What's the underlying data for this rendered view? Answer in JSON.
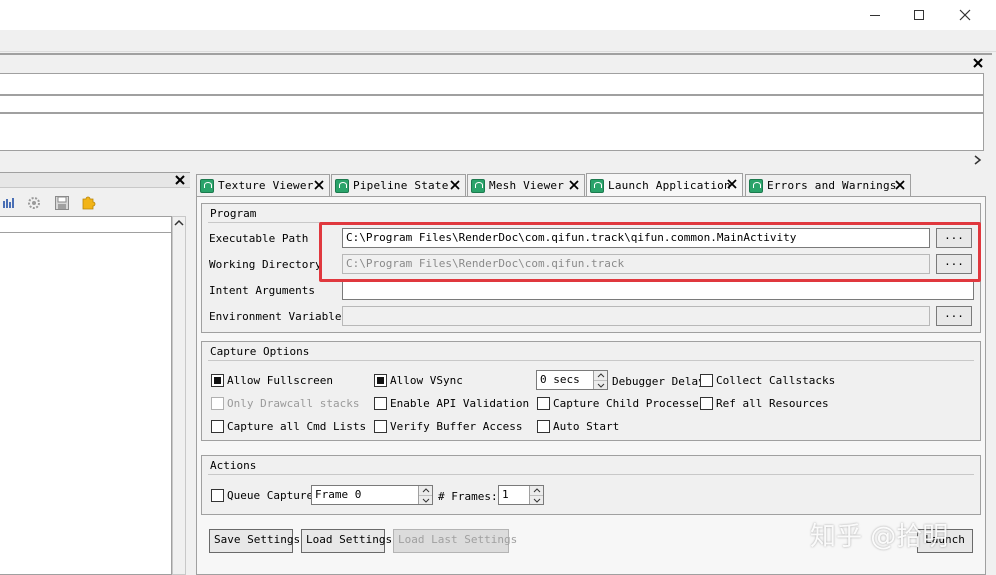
{
  "window": {
    "controls": [
      "minimize-icon",
      "maximize-icon",
      "close-icon"
    ]
  },
  "tabs": [
    {
      "label": "Texture Viewer",
      "active": false
    },
    {
      "label": "Pipeline State",
      "active": false
    },
    {
      "label": "Mesh Viewer",
      "active": false
    },
    {
      "label": "Launch Application",
      "active": true
    },
    {
      "label": "Errors and Warnings",
      "active": false
    }
  ],
  "program": {
    "title": "Program",
    "executable_path_label": "Executable Path",
    "executable_path_value": "C:\\Program Files\\RenderDoc\\com.qifun.track\\qifun.common.MainActivity",
    "working_directory_label": "Working Directory",
    "working_directory_value": "C:\\Program Files\\RenderDoc\\com.qifun.track",
    "intent_arguments_label": "Intent Arguments",
    "intent_arguments_value": "",
    "environment_variables_label": "Environment Variables",
    "environment_variables_value": "",
    "browse_label": "..."
  },
  "capture_options": {
    "title": "Capture Options",
    "allow_fullscreen": "Allow Fullscreen",
    "only_drawcall_stacks": "Only Drawcall stacks",
    "capture_all_cmd_lists": "Capture all Cmd Lists",
    "allow_vsync": "Allow VSync",
    "enable_api_validation": "Enable API Validation",
    "verify_buffer_access": "Verify Buffer Access",
    "debugger_delay_value": "0 secs",
    "debugger_delay_label": "Debugger Delay",
    "capture_child_processes": "Capture Child Processes",
    "auto_start": "Auto Start",
    "collect_callstacks": "Collect Callstacks",
    "ref_all_resources": "Ref all Resources"
  },
  "actions": {
    "title": "Actions",
    "queue_capture": "Queue Capture",
    "queue_frame_value": "Frame 0",
    "frames_label": "# Frames:",
    "frames_value": "1"
  },
  "buttons": {
    "save_settings": "Save Settings",
    "load_settings": "Load Settings",
    "load_last_settings": "Load Last Settings",
    "launch": "Launch"
  },
  "watermark": "知乎 @拾明",
  "colors": {
    "highlight": "#e0383e",
    "tab_icon": "#2aa36a"
  }
}
